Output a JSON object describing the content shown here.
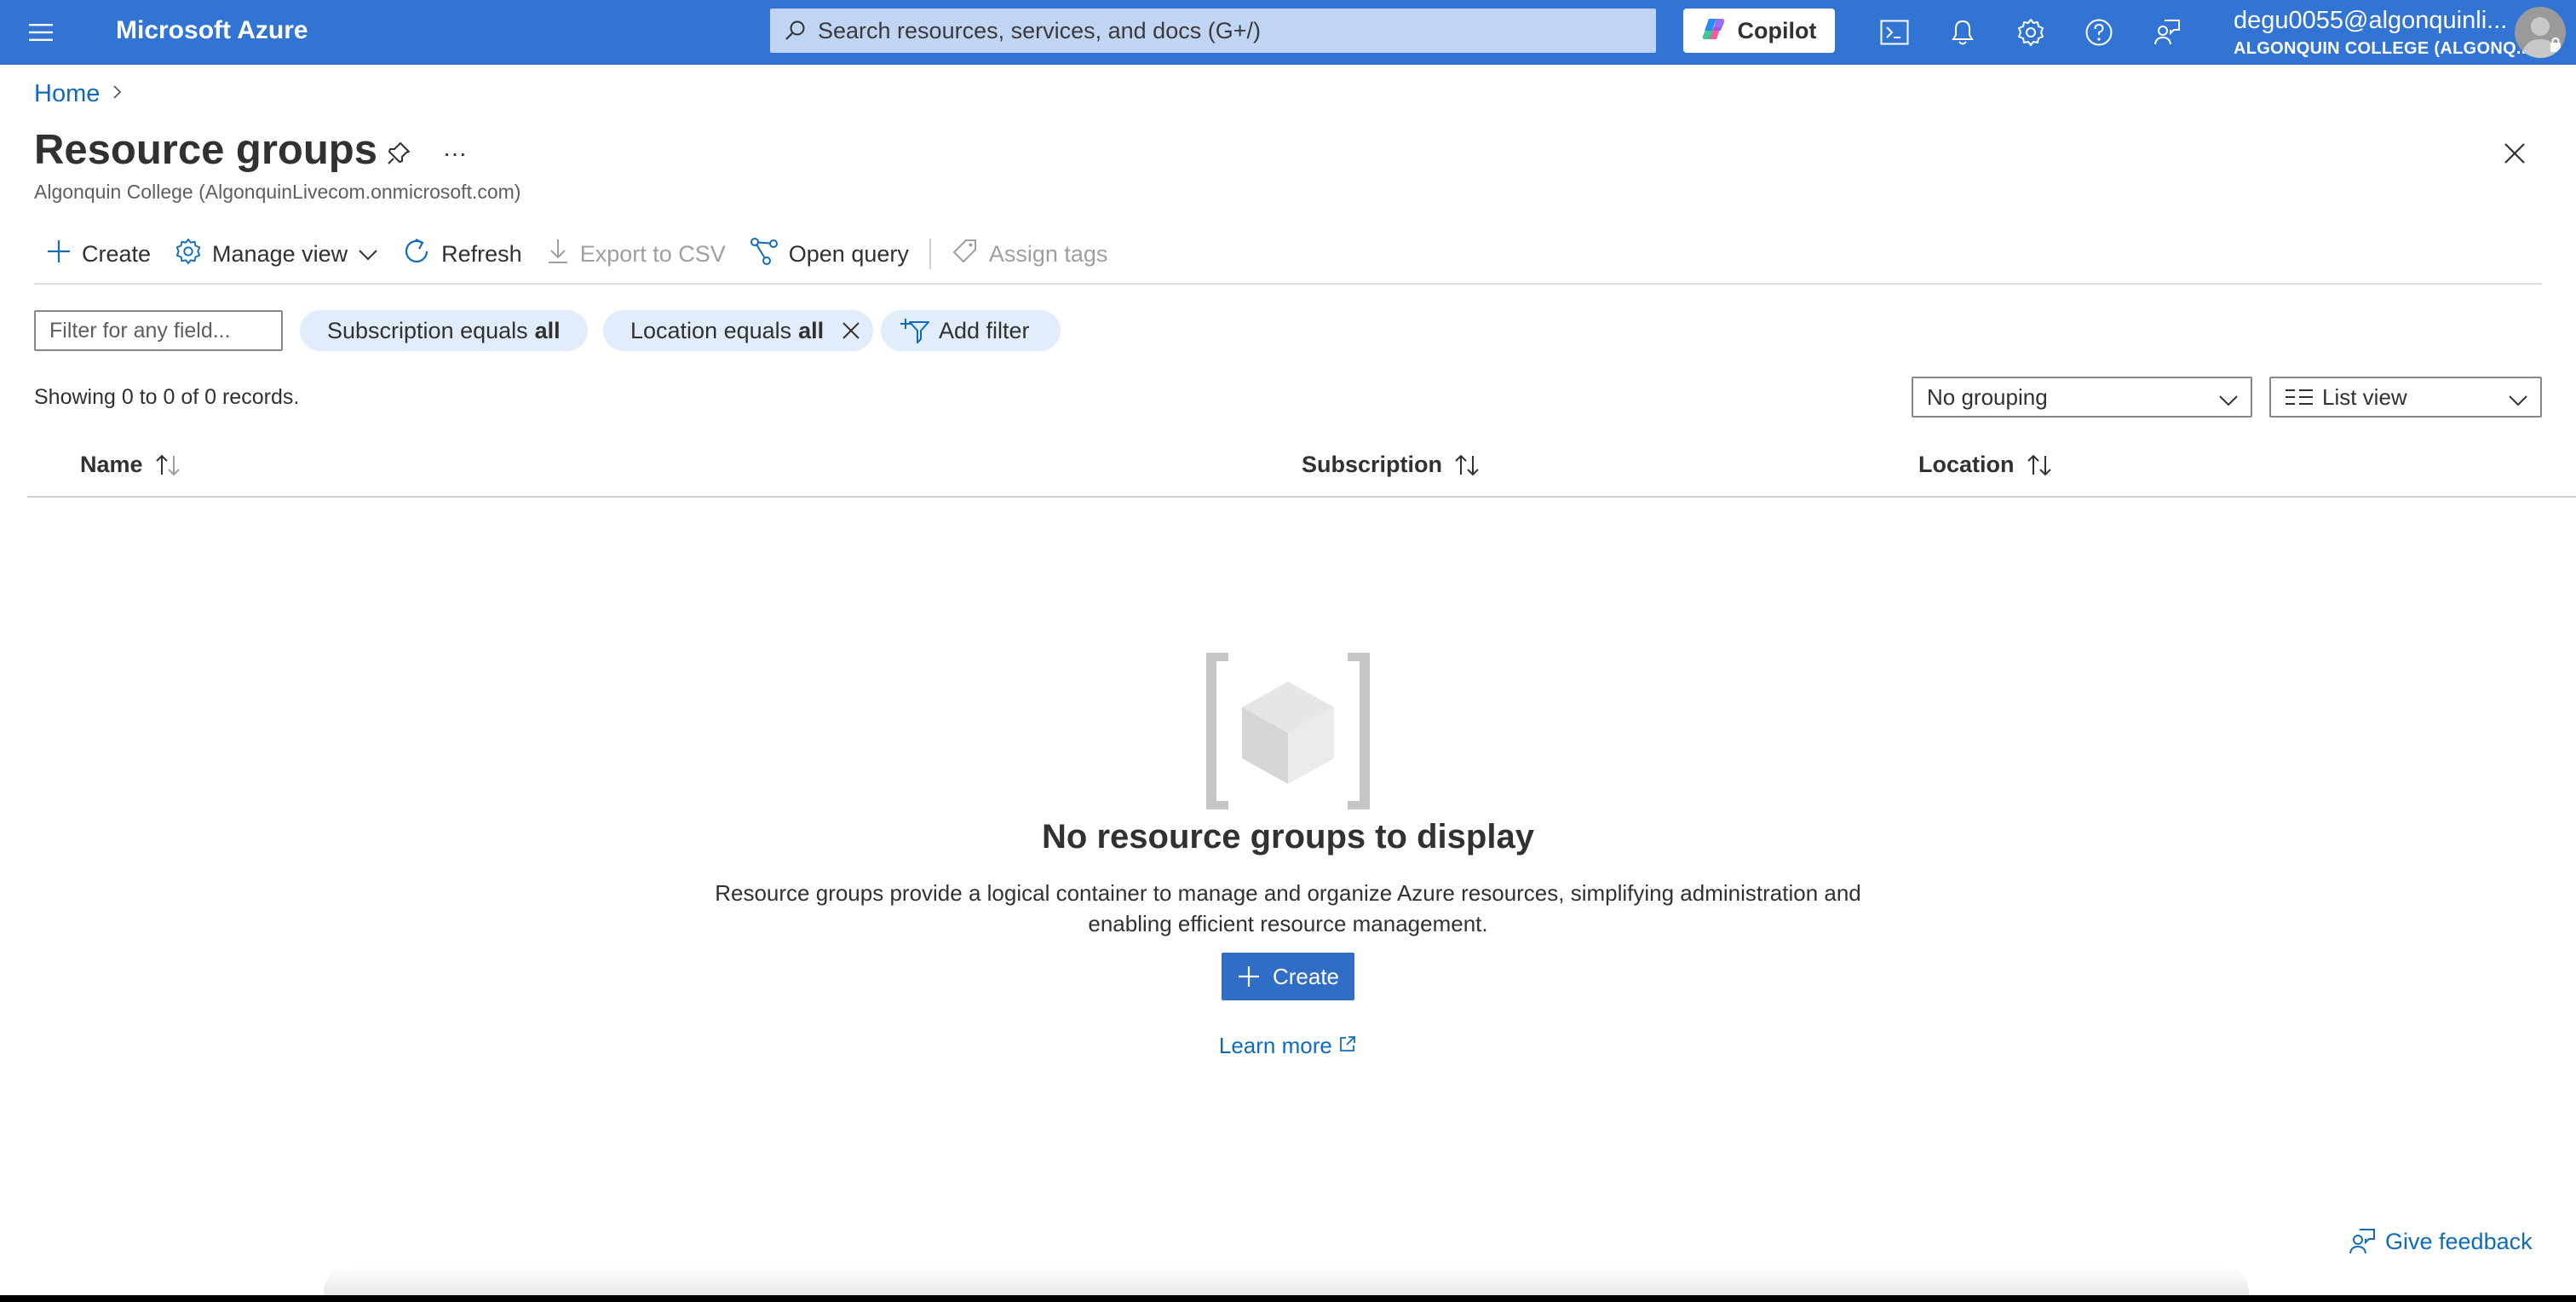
{
  "topbar": {
    "brand": "Microsoft Azure",
    "search_placeholder": "Search resources, services, and docs (G+/)",
    "copilot_label": "Copilot",
    "account_email": "degu0055@algonquinli...",
    "account_org": "ALGONQUIN COLLEGE (ALGONQ..."
  },
  "breadcrumb": {
    "home": "Home"
  },
  "header": {
    "title": "Resource groups",
    "more": "···",
    "subtitle": "Algonquin College (AlgonquinLivecom.onmicrosoft.com)"
  },
  "toolbar": {
    "create": "Create",
    "manage_view": "Manage view",
    "refresh": "Refresh",
    "export_csv": "Export to CSV",
    "open_query": "Open query",
    "assign_tags": "Assign tags"
  },
  "filters": {
    "placeholder": "Filter for any field...",
    "subscription_prefix": "Subscription equals",
    "subscription_value": "all",
    "location_prefix": "Location equals",
    "location_value": "all",
    "add_filter": "Add filter"
  },
  "records_text": "Showing 0 to 0 of 0 records.",
  "grouping": {
    "selected": "No grouping"
  },
  "view": {
    "selected": "List view"
  },
  "table": {
    "columns": [
      {
        "label": "Name"
      },
      {
        "label": "Subscription"
      },
      {
        "label": "Location"
      }
    ]
  },
  "empty_state": {
    "title": "No resource groups to display",
    "description_line1": "Resource groups provide a logical container to manage and organize Azure resources, simplifying administration and",
    "description_line2": "enabling efficient resource management.",
    "create_label": "Create",
    "learn_more": "Learn more"
  },
  "feedback_label": "Give feedback",
  "colors": {
    "topbar": "#3274d3",
    "link": "#0f6cbd",
    "primary_button": "#2f6dc6",
    "pill": "#e1edfa"
  }
}
